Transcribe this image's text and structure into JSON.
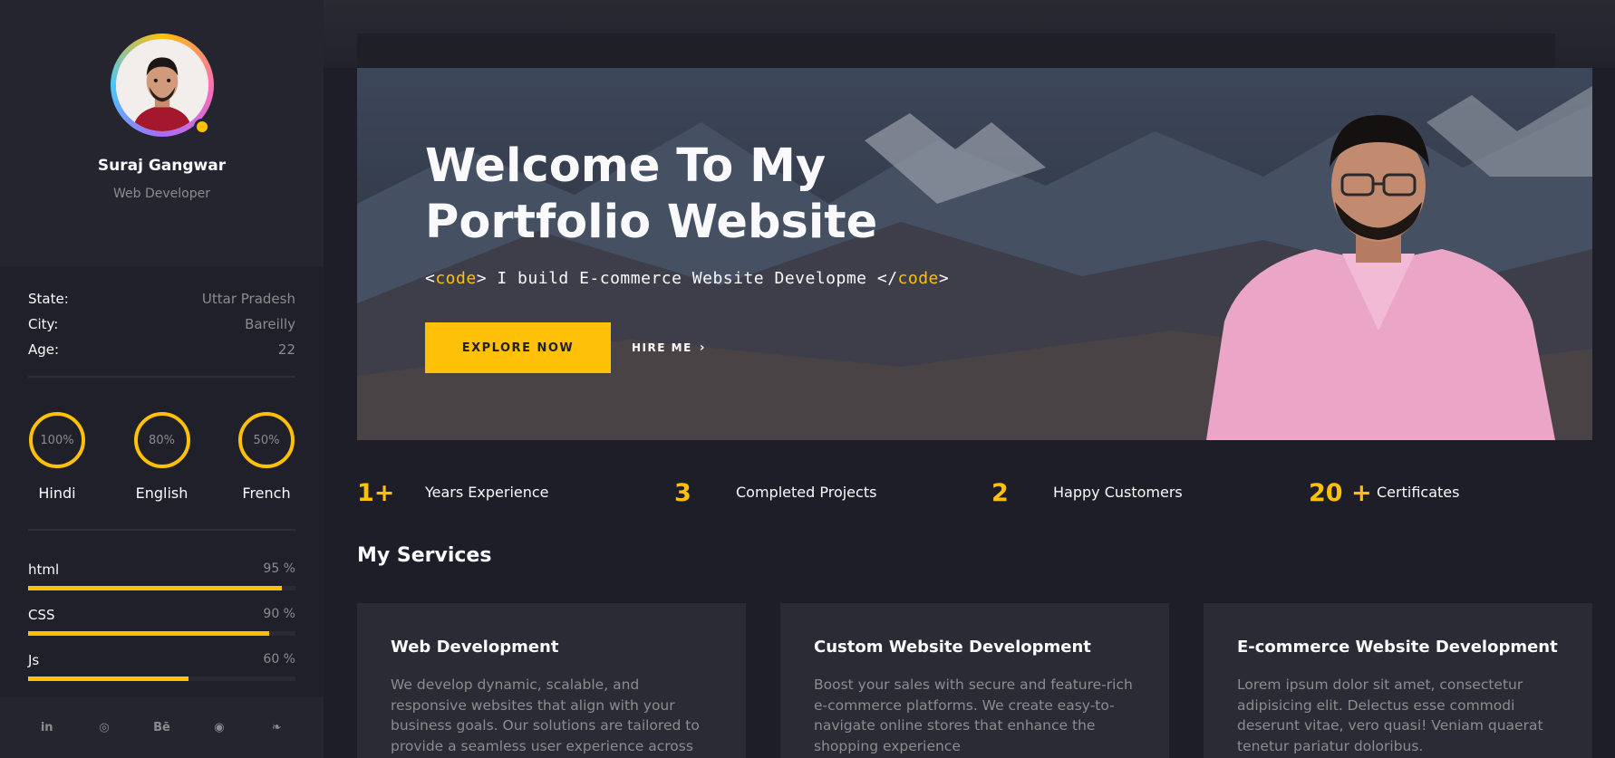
{
  "profile": {
    "name": "Suraj Gangwar",
    "role": "Web Developer"
  },
  "info": [
    {
      "key": "State:",
      "value": "Uttar Pradesh"
    },
    {
      "key": "City:",
      "value": "Bareilly"
    },
    {
      "key": "Age:",
      "value": "22"
    }
  ],
  "languages": [
    {
      "name": "Hindi",
      "percent": "100%"
    },
    {
      "name": "English",
      "percent": "80%"
    },
    {
      "name": "French",
      "percent": "50%"
    }
  ],
  "skills": [
    {
      "name": "html",
      "percent_label": "95 %",
      "level": 95
    },
    {
      "name": "CSS",
      "percent_label": "90 %",
      "level": 90
    },
    {
      "name": "Js",
      "percent_label": "60 %",
      "level": 60
    }
  ],
  "socials": [
    {
      "icon": "linkedin-icon",
      "glyph": "in"
    },
    {
      "icon": "dribbble-icon",
      "glyph": "◎"
    },
    {
      "icon": "behance-icon",
      "glyph": "Bē"
    },
    {
      "icon": "github-icon",
      "glyph": "◉"
    },
    {
      "icon": "twitter-icon",
      "glyph": "❧"
    }
  ],
  "hero": {
    "title_line1": "Welcome To My",
    "title_line2": "Portfolio Website",
    "code_open_lt": "<",
    "code_open_tag": "code",
    "code_open_gt": ">",
    "code_text": " I build E-commerce Website Developme ",
    "code_close_lt": "</",
    "code_close_tag": "code",
    "code_close_gt": ">",
    "explore_label": "EXPLORE NOW",
    "hire_label": "HIRE ME"
  },
  "stats": [
    {
      "number": "1+",
      "label": "Years Experience"
    },
    {
      "number": "3",
      "label": "Completed Projects"
    },
    {
      "number": "2",
      "label": "Happy Customers"
    },
    {
      "number": "20 +",
      "label": "Certificates"
    }
  ],
  "services": {
    "title": "My Services",
    "cards": [
      {
        "title": "Web Development",
        "text": "We develop dynamic, scalable, and responsive websites that align with your business goals. Our solutions are tailored to provide a seamless user experience across"
      },
      {
        "title": "Custom Website Development",
        "text": "Boost your sales with secure and feature-rich e-commerce platforms. We create easy-to-navigate online stores that enhance the shopping experience"
      },
      {
        "title": "E-commerce Website Development",
        "text": "Lorem ipsum dolor sit amet, consectetur adipisicing elit. Delectus esse commodi deserunt vitae, vero quasi! Veniam quaerat tenetur pariatur doloribus."
      }
    ]
  },
  "colors": {
    "accent": "#ffc107",
    "background": "#1e1e28",
    "sidebar": "#20202a",
    "card": "#2b2b36",
    "muted_text": "#8c8c8e"
  }
}
